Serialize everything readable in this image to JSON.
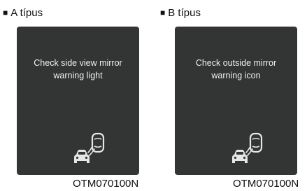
{
  "panels": [
    {
      "type_marker": "■",
      "type_label": "A típus",
      "message_line1": "Check side view mirror",
      "message_line2": "warning light",
      "icon": "blind-spot-vehicle-icon",
      "image_code": "OTM070100N"
    },
    {
      "type_marker": "■",
      "type_label": "B típus",
      "message_line1": "Check outside mirror",
      "message_line2": "warning icon",
      "icon": "blind-spot-vehicle-icon",
      "image_code": "OTM070100N"
    }
  ],
  "colors": {
    "panel_bg": "#333434",
    "panel_text": "#f2f2f2",
    "icon_color": "#e6e6e6",
    "page_text": "#111111"
  }
}
